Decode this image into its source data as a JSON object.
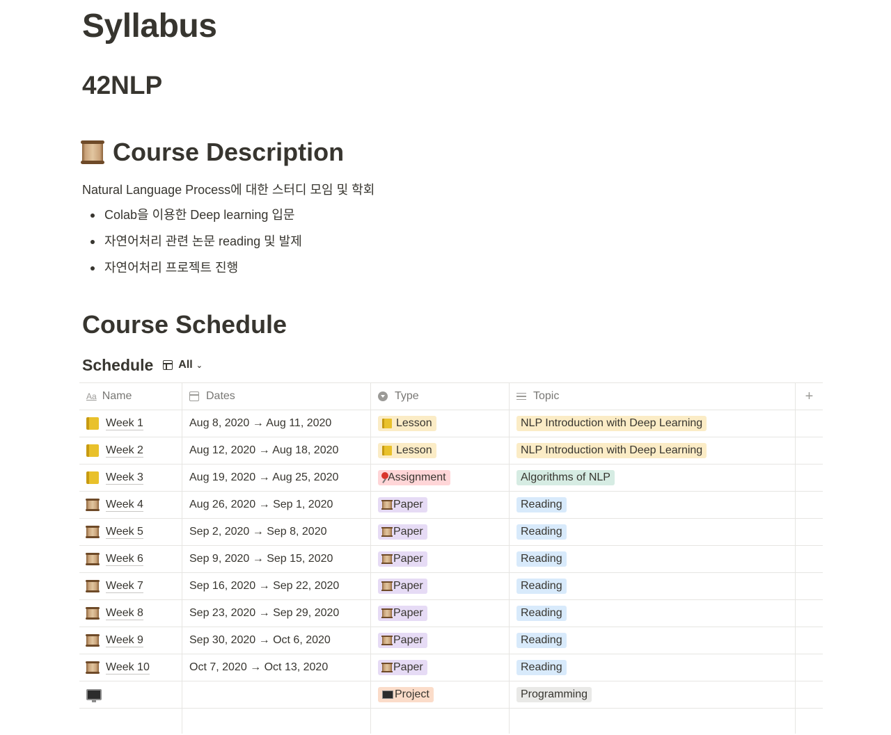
{
  "page": {
    "title": "Syllabus",
    "subtitle": "42NLP",
    "desc_heading": "Course Description",
    "intro": "Natural Language Process에 대한 스터디 모임 및 학회",
    "bullets": [
      "Colab을 이용한 Deep learning 입문",
      "자연어처리 관련 논문 reading 및 발제",
      "자연어처리 프로젝트 진행"
    ],
    "schedule_heading": "Course Schedule"
  },
  "database": {
    "title": "Schedule",
    "view_label": "All",
    "columns": {
      "name": "Name",
      "dates": "Dates",
      "type": "Type",
      "topic": "Topic",
      "name_icon": "Aa"
    },
    "rows": [
      {
        "icon": "ledger",
        "name": "Week 1",
        "dates": "Aug 8, 2020 → Aug 11, 2020",
        "type": "Lesson",
        "type_icon": "ledger",
        "type_color": "#fbecc6",
        "topic": "NLP Introduction with Deep Learning",
        "topic_color": "#fbecc6"
      },
      {
        "icon": "ledger",
        "name": "Week 2",
        "dates": "Aug 12, 2020 → Aug 18, 2020",
        "type": "Lesson",
        "type_icon": "ledger",
        "type_color": "#fbecc6",
        "topic": "NLP Introduction with Deep Learning",
        "topic_color": "#fbecc6"
      },
      {
        "icon": "ledger",
        "name": "Week 3",
        "dates": "Aug 19, 2020 → Aug 25, 2020",
        "type": "Assignment",
        "type_icon": "pin",
        "type_color": "#ffd6d8",
        "topic": "Algorithms of NLP",
        "topic_color": "#d6ece3"
      },
      {
        "icon": "scroll",
        "name": "Week 4",
        "dates": "Aug 26, 2020 → Sep 1, 2020",
        "type": "Paper",
        "type_icon": "scroll",
        "type_color": "#e6dbf5",
        "topic": "Reading",
        "topic_color": "#d8eafb"
      },
      {
        "icon": "scroll",
        "name": "Week 5",
        "dates": "Sep 2, 2020 → Sep 8, 2020",
        "type": "Paper",
        "type_icon": "scroll",
        "type_color": "#e6dbf5",
        "topic": "Reading",
        "topic_color": "#d8eafb"
      },
      {
        "icon": "scroll",
        "name": "Week 6",
        "dates": "Sep 9, 2020 → Sep 15, 2020",
        "type": "Paper",
        "type_icon": "scroll",
        "type_color": "#e6dbf5",
        "topic": "Reading",
        "topic_color": "#d8eafb"
      },
      {
        "icon": "scroll",
        "name": "Week 7",
        "dates": "Sep 16, 2020 → Sep 22, 2020",
        "type": "Paper",
        "type_icon": "scroll",
        "type_color": "#e6dbf5",
        "topic": "Reading",
        "topic_color": "#d8eafb"
      },
      {
        "icon": "scroll",
        "name": "Week 8",
        "dates": "Sep 23, 2020 → Sep 29, 2020",
        "type": "Paper",
        "type_icon": "scroll",
        "type_color": "#e6dbf5",
        "topic": "Reading",
        "topic_color": "#d8eafb"
      },
      {
        "icon": "scroll",
        "name": "Week 9",
        "dates": "Sep 30, 2020 → Oct 6, 2020",
        "type": "Paper",
        "type_icon": "scroll",
        "type_color": "#e6dbf5",
        "topic": "Reading",
        "topic_color": "#d8eafb"
      },
      {
        "icon": "scroll",
        "name": "Week 10",
        "dates": "Oct 7, 2020 → Oct 13, 2020",
        "type": "Paper",
        "type_icon": "scroll",
        "type_color": "#e6dbf5",
        "topic": "Reading",
        "topic_color": "#d8eafb"
      },
      {
        "icon": "pc",
        "name": "",
        "dates": "",
        "type": "Project",
        "type_icon": "pc",
        "type_color": "#fbdcc9",
        "topic": "Programming",
        "topic_color": "#e9e9e7"
      }
    ]
  }
}
